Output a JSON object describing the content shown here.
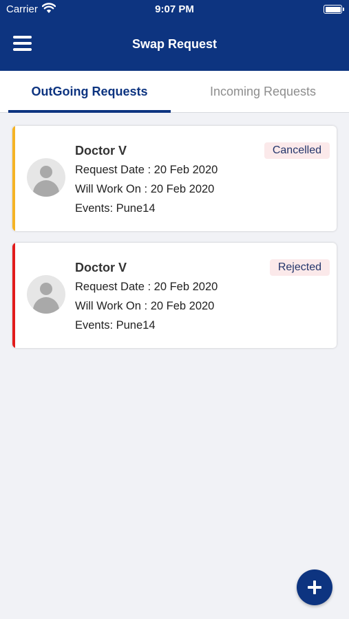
{
  "status_bar": {
    "carrier": "Carrier",
    "time": "9:07 PM"
  },
  "header": {
    "title": "Swap Request"
  },
  "tabs": [
    {
      "label": "OutGoing Requests",
      "active": true
    },
    {
      "label": "Incoming Requests",
      "active": false
    }
  ],
  "requests": [
    {
      "name": "Doctor V",
      "request_date": "Request Date : 20 Feb 2020",
      "will_work_on": "Will Work On : 20 Feb 2020",
      "events": "Events: Pune14",
      "status": "Cancelled",
      "accent_color": "#f5b324"
    },
    {
      "name": "Doctor V",
      "request_date": "Request Date : 20 Feb 2020",
      "will_work_on": "Will Work On : 20 Feb 2020",
      "events": "Events: Pune14",
      "status": "Rejected",
      "accent_color": "#e21b1b"
    }
  ],
  "colors": {
    "primary": "#0d3480",
    "background": "#f1f2f6",
    "badge_bg": "#fbe9ea"
  },
  "fab": {
    "icon": "plus-icon"
  }
}
